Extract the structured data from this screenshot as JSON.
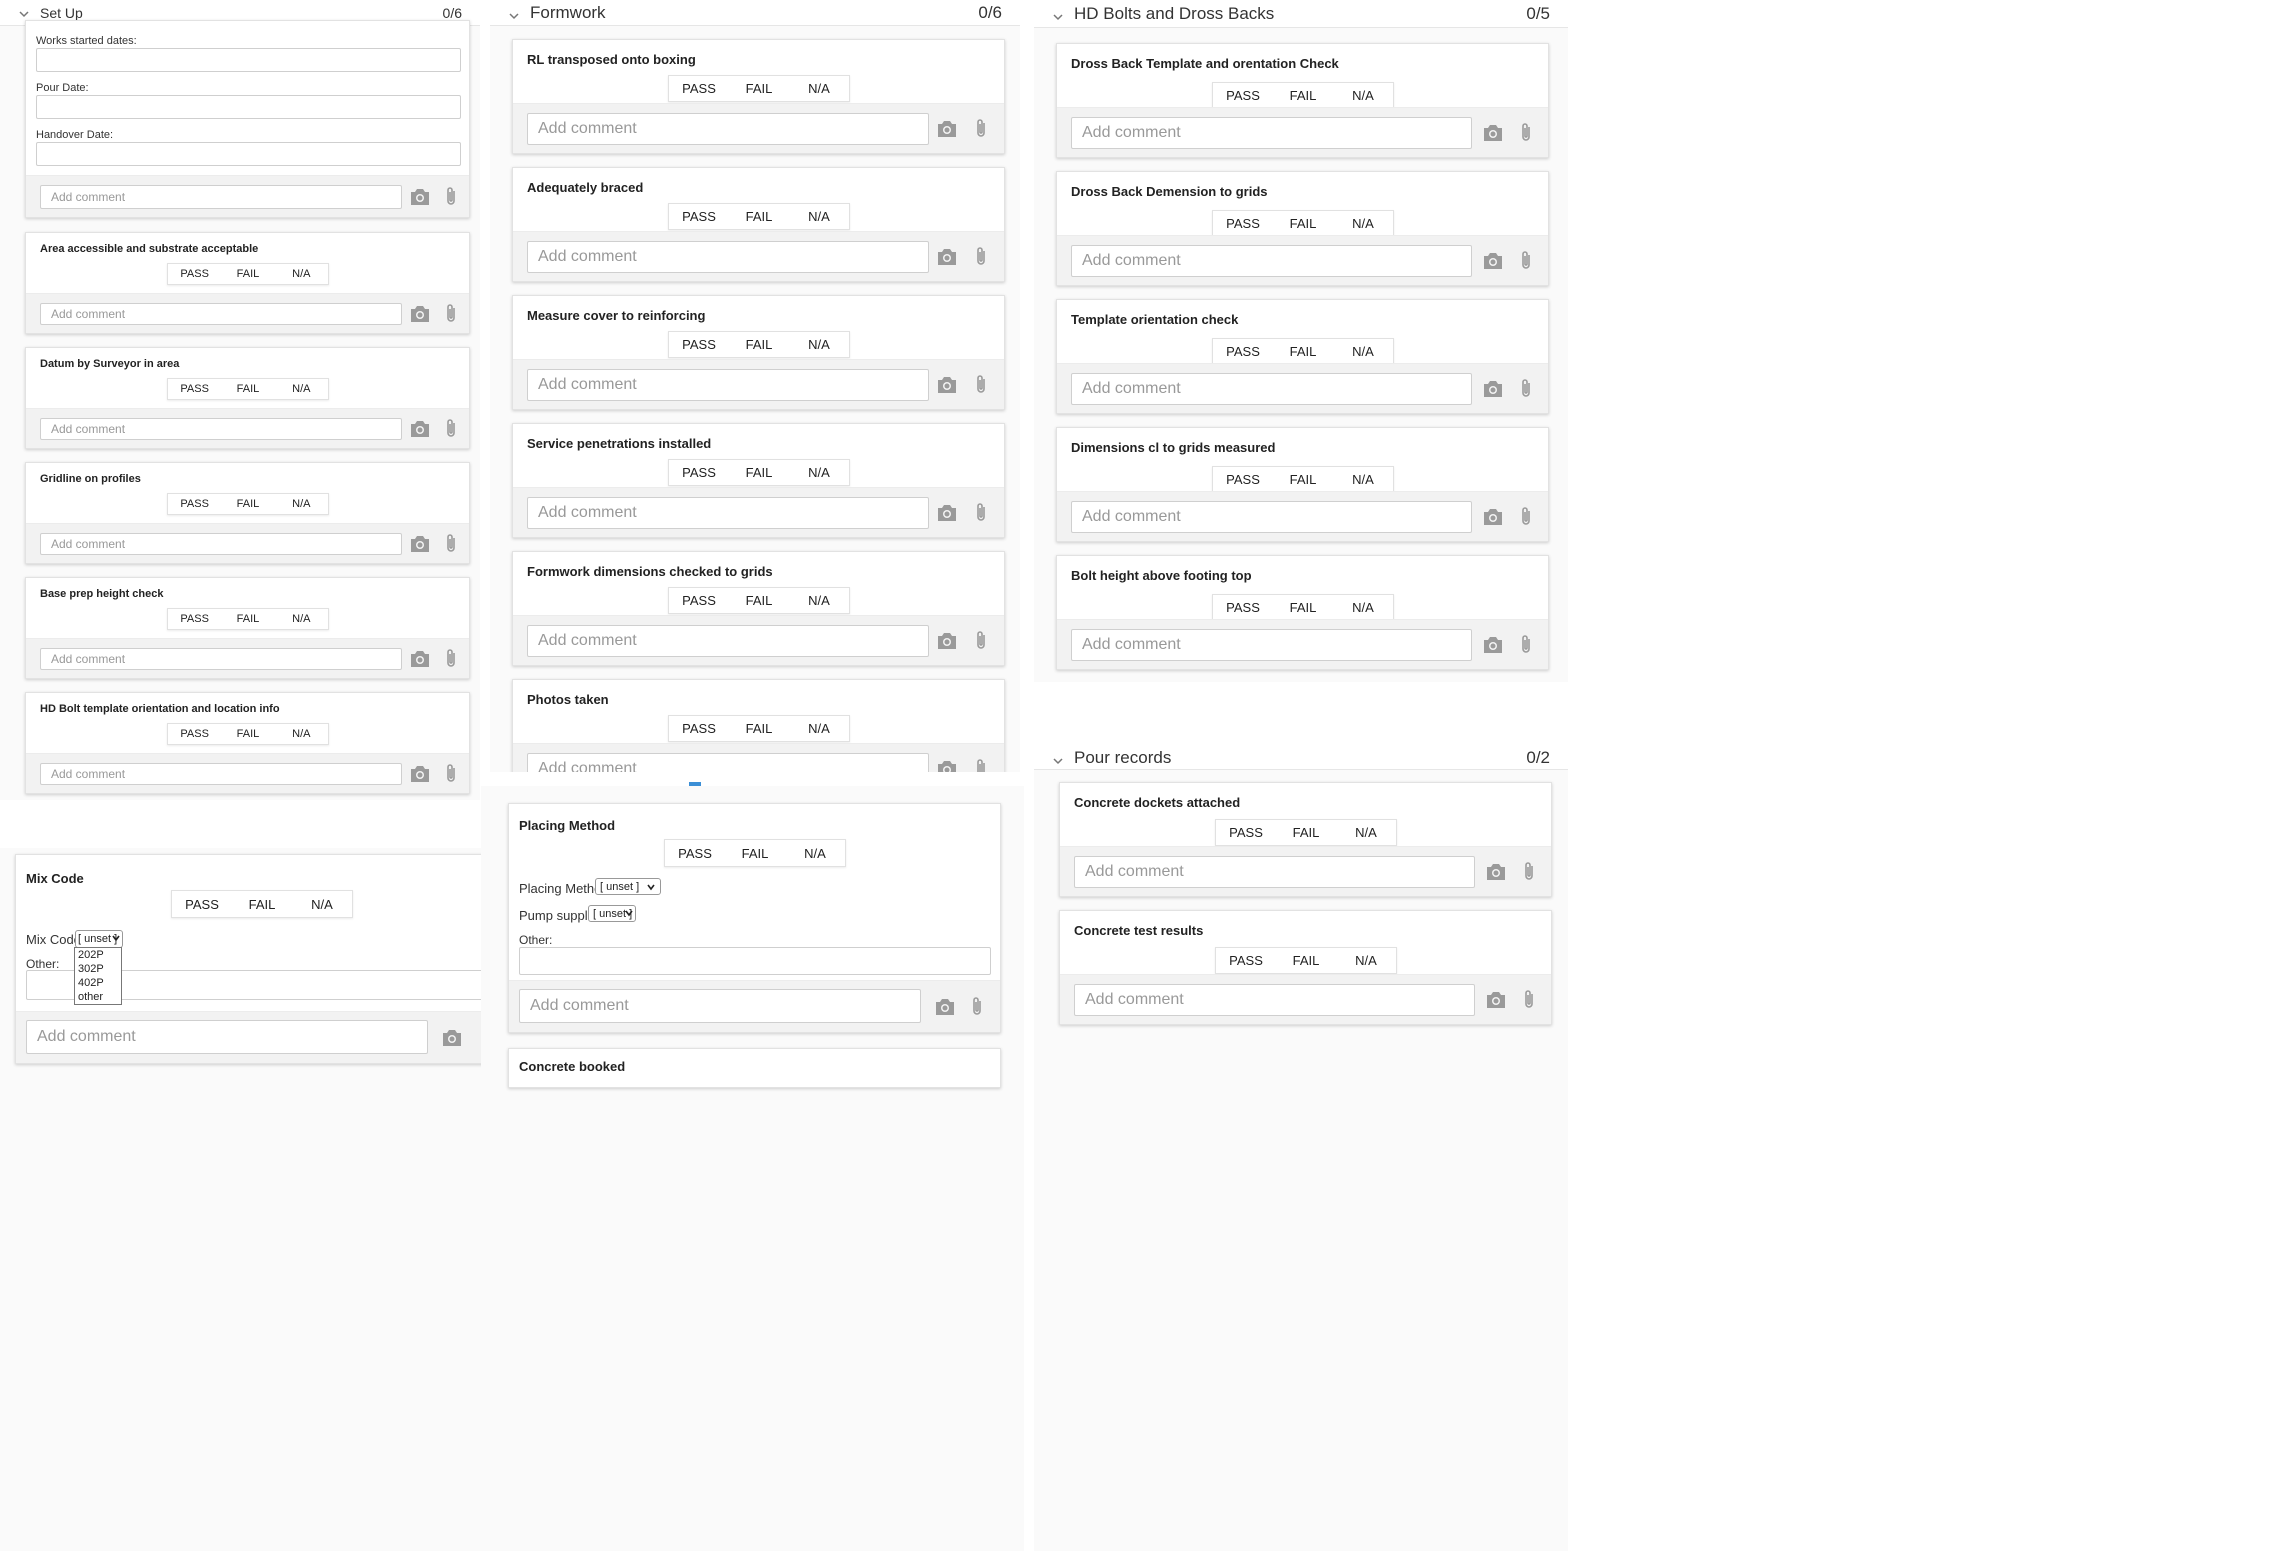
{
  "ui": {
    "pass": "PASS",
    "fail": "FAIL",
    "na": "N/A",
    "comment_placeholder": "Add comment"
  },
  "setup": {
    "title": "Set Up",
    "count": "0/6",
    "date_labels": [
      "Works started dates:",
      "Pour Date:",
      "Handover Date:"
    ],
    "items": [
      "Area accessible and substrate acceptable",
      "Datum by Surveyor in area",
      "Gridline on profiles",
      "Base prep height check",
      "HD Bolt template orientation and location info"
    ]
  },
  "formwork": {
    "title": "Formwork",
    "count": "0/6",
    "items": [
      "RL transposed onto boxing",
      "Adequately braced",
      "Measure cover to reinforcing",
      "Service penetrations installed",
      "Formwork dimensions checked to grids",
      "Photos taken"
    ]
  },
  "hdbolts": {
    "title": "HD Bolts and Dross Backs",
    "count": "0/5",
    "items": [
      "Dross Back Template and orentation Check",
      "Dross Back Demension to grids",
      "Template orientation check",
      "Dimensions cl to grids measured",
      "Bolt height above footing top"
    ]
  },
  "mix": {
    "title": "Mix Code",
    "field_label": "Mix Code:",
    "selected": "[ unset ]",
    "other_label": "Other:",
    "options": [
      "202P",
      "302P",
      "402P",
      "other"
    ]
  },
  "placing": {
    "title": "Placing Method",
    "method_label": "Placing Method:",
    "method_value": "[ unset ]",
    "supplier_label": "Pump supplier",
    "supplier_value": "[ unset ]",
    "other_label": "Other:",
    "next_title": "Concrete booked"
  },
  "pour": {
    "title": "Pour records",
    "count": "0/2",
    "items": [
      "Concrete dockets attached",
      "Concrete test results"
    ]
  },
  "icons": {
    "camera": "camera-icon",
    "attach": "paperclip-icon",
    "chevron": "chevron-down-icon"
  },
  "colors": {
    "accent": "#3b8fd6",
    "border": "#e2e2e2",
    "muted": "#999999"
  }
}
